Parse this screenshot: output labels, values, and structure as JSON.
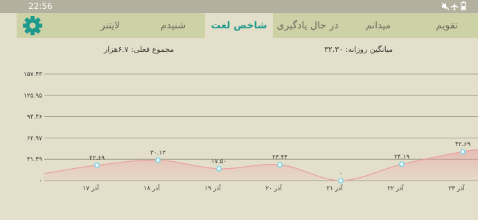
{
  "status_bar": {
    "time": "22:56",
    "icons": [
      "battery-icon",
      "airplane-mode-icon",
      "muted-icon"
    ]
  },
  "tabs": [
    {
      "label": "تقویم",
      "active": false
    },
    {
      "label": "میدانم",
      "active": false
    },
    {
      "label": "در حال یادگیری",
      "active": false
    },
    {
      "label": "شاخص لغت",
      "active": true
    },
    {
      "label": "شنیدم",
      "active": false
    },
    {
      "label": "لایتنر",
      "active": false
    }
  ],
  "settings_icon": "gear-icon",
  "summary": {
    "daily_average": "میانگین روزانه: ۳۲.۳۰",
    "current_total": "مجموع فعلی: ۶.۷هزار"
  },
  "colors": {
    "accent": "#1e9a8d",
    "tab_bar": "#ccd2a6",
    "background": "#e4dfcb",
    "line": "#e8a0a0",
    "point": "#7ad4ea"
  },
  "chart_data": {
    "type": "area",
    "categories": [
      "۱۷ آذر",
      "۱۸ آذر",
      "۱۹ آذر",
      "۲۰ آذر",
      "۲۱ آذر",
      "۲۲ آذر",
      "۲۳ آذر"
    ],
    "values": [
      22.69,
      30.13,
      17.5,
      23.44,
      0,
      24.19,
      42.69
    ],
    "value_labels": [
      "۲۲.۶۹",
      "۳۰.۱۳",
      "۱۷.۵۰",
      "۲۳.۴۴",
      "۰",
      "۲۴.۱۹",
      "۴۲.۶۹"
    ],
    "y_ticks": [
      "۰",
      "۳۱.۴۹",
      "۶۲.۹۷",
      "۹۴.۴۶",
      "۱۲۵.۹۵",
      "۱۵۷.۴۳"
    ],
    "y_tick_values": [
      0,
      31.49,
      62.97,
      94.46,
      125.95,
      157.43
    ],
    "ylim": [
      0,
      157.43
    ],
    "grid": true,
    "title": "",
    "xlabel": "",
    "ylabel": ""
  }
}
